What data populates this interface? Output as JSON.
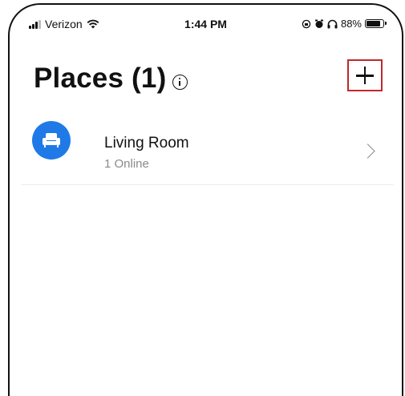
{
  "status_bar": {
    "carrier": "Verizon",
    "time": "1:44 PM",
    "battery": "88%",
    "icons": [
      "signal-icon",
      "wifi-icon",
      "screen-lock-icon",
      "alarm-icon",
      "headphones-icon",
      "battery-icon"
    ]
  },
  "header": {
    "title": "Places (1)",
    "add_button_icon": "plus-icon",
    "info_icon": "info-icon"
  },
  "places": [
    {
      "name": "Living Room",
      "status": "1 Online",
      "icon": "sofa-icon"
    }
  ],
  "colors": {
    "accent": "#1f7ae8",
    "highlight": "#c0282d"
  }
}
